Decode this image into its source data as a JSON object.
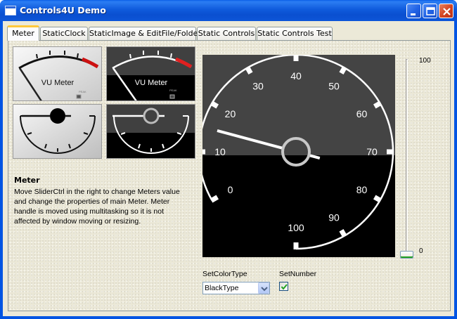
{
  "window": {
    "title": "Controls4U Demo"
  },
  "tabs": [
    {
      "label": "Meter",
      "active": true
    },
    {
      "label": "StaticClock",
      "active": false
    },
    {
      "label": "StaticImage & EditFile/Folder",
      "active": false
    },
    {
      "label": "Static Controls",
      "active": false
    },
    {
      "label": "Static Controls Test",
      "active": false
    }
  ],
  "previews": {
    "vu_label": "VU Meter",
    "peak_label": "PEAK"
  },
  "info": {
    "title": "Meter",
    "text": "Move SliderCtrl in the right to change Meters value and change the properties of main Meter. Meter handle is moved using multitasking  so it is not affected by window moving or resizing."
  },
  "meter": {
    "scale_labels": [
      "0",
      "10",
      "20",
      "30",
      "40",
      "50",
      "60",
      "70",
      "80",
      "90",
      "100"
    ],
    "value": 15,
    "min": 0,
    "max": 100
  },
  "slider": {
    "max_label": "100",
    "min_label": "0",
    "value": 0
  },
  "controls": {
    "color_type_label": "SetColorType",
    "color_type_value": "BlackType",
    "set_number_label": "SetNumber",
    "set_number_checked": true
  },
  "colors": {
    "accent": "#ffc83c",
    "titlebar": "#0a4fd0",
    "meter_red": "#cc1111",
    "checkbox_green": "#21a121"
  }
}
